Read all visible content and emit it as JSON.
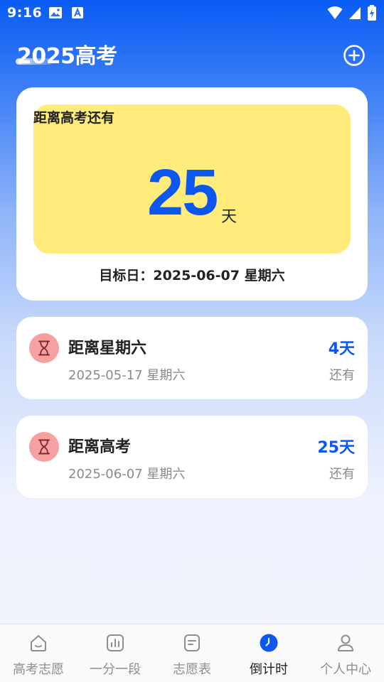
{
  "status_bar": {
    "time": "9:16"
  },
  "header": {
    "title": "2025高考"
  },
  "countdown": {
    "label": "距离高考还有",
    "days": "25",
    "unit": "天",
    "target_prefix": "目标日：",
    "target_date": "2025-06-07 星期六"
  },
  "events": [
    {
      "title": "距离星期六",
      "date": "2025-05-17 星期六",
      "days": "4天",
      "status": "还有"
    },
    {
      "title": "距离高考",
      "date": "2025-06-07 星期六",
      "days": "25天",
      "status": "还有"
    }
  ],
  "nav": {
    "items": [
      {
        "label": "高考志愿",
        "icon": "home-icon"
      },
      {
        "label": "一分一段",
        "icon": "chart-icon"
      },
      {
        "label": "志愿表",
        "icon": "form-icon"
      },
      {
        "label": "倒计时",
        "icon": "clock-icon",
        "active": true
      },
      {
        "label": "个人中心",
        "icon": "person-icon"
      }
    ]
  },
  "colors": {
    "accent": "#0b57f0",
    "highlight": "#ffec7a",
    "event_icon_bg": "#f7a0a0"
  }
}
